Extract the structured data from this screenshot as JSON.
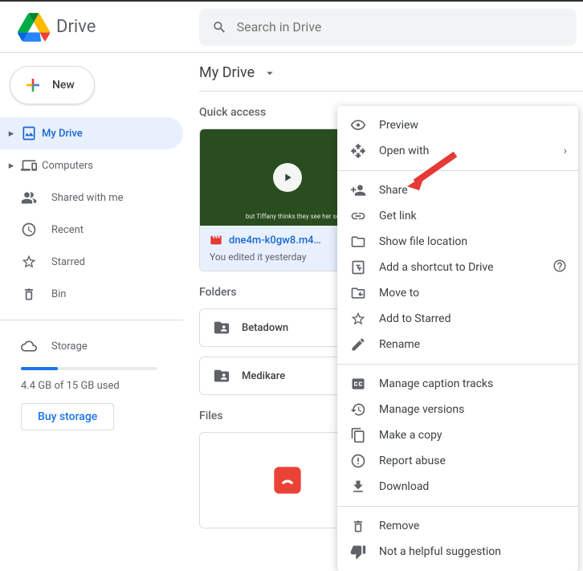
{
  "app": {
    "name": "Drive"
  },
  "search": {
    "placeholder": "Search in Drive"
  },
  "sidebar": {
    "new_label": "New",
    "items": [
      {
        "label": "My Drive"
      },
      {
        "label": "Computers"
      },
      {
        "label": "Shared with me"
      },
      {
        "label": "Recent"
      },
      {
        "label": "Starred"
      },
      {
        "label": "Bin"
      }
    ],
    "storage_label": "Storage",
    "storage_used": "4.4 GB of 15 GB used",
    "buy_label": "Buy storage"
  },
  "main": {
    "breadcrumb": "My Drive",
    "sections": {
      "quick": "Quick access",
      "folders": "Folders",
      "files": "Files"
    },
    "quick_card": {
      "title": "dne4m-k0gw8.m4…",
      "subtitle": "You edited it yesterday",
      "thumb_caption": "but Tiffany thinks\nthey see her so spook"
    },
    "folders": [
      {
        "name": "Betadown"
      },
      {
        "name": "Medikare"
      }
    ]
  },
  "menu": {
    "items": [
      {
        "label": "Preview"
      },
      {
        "label": "Open with"
      },
      {
        "label": "Share"
      },
      {
        "label": "Get link"
      },
      {
        "label": "Show file location"
      },
      {
        "label": "Add a shortcut to Drive"
      },
      {
        "label": "Move to"
      },
      {
        "label": "Add to Starred"
      },
      {
        "label": "Rename"
      },
      {
        "label": "Manage caption tracks"
      },
      {
        "label": "Manage versions"
      },
      {
        "label": "Make a copy"
      },
      {
        "label": "Report abuse"
      },
      {
        "label": "Download"
      },
      {
        "label": "Remove"
      },
      {
        "label": "Not a helpful suggestion"
      }
    ]
  }
}
